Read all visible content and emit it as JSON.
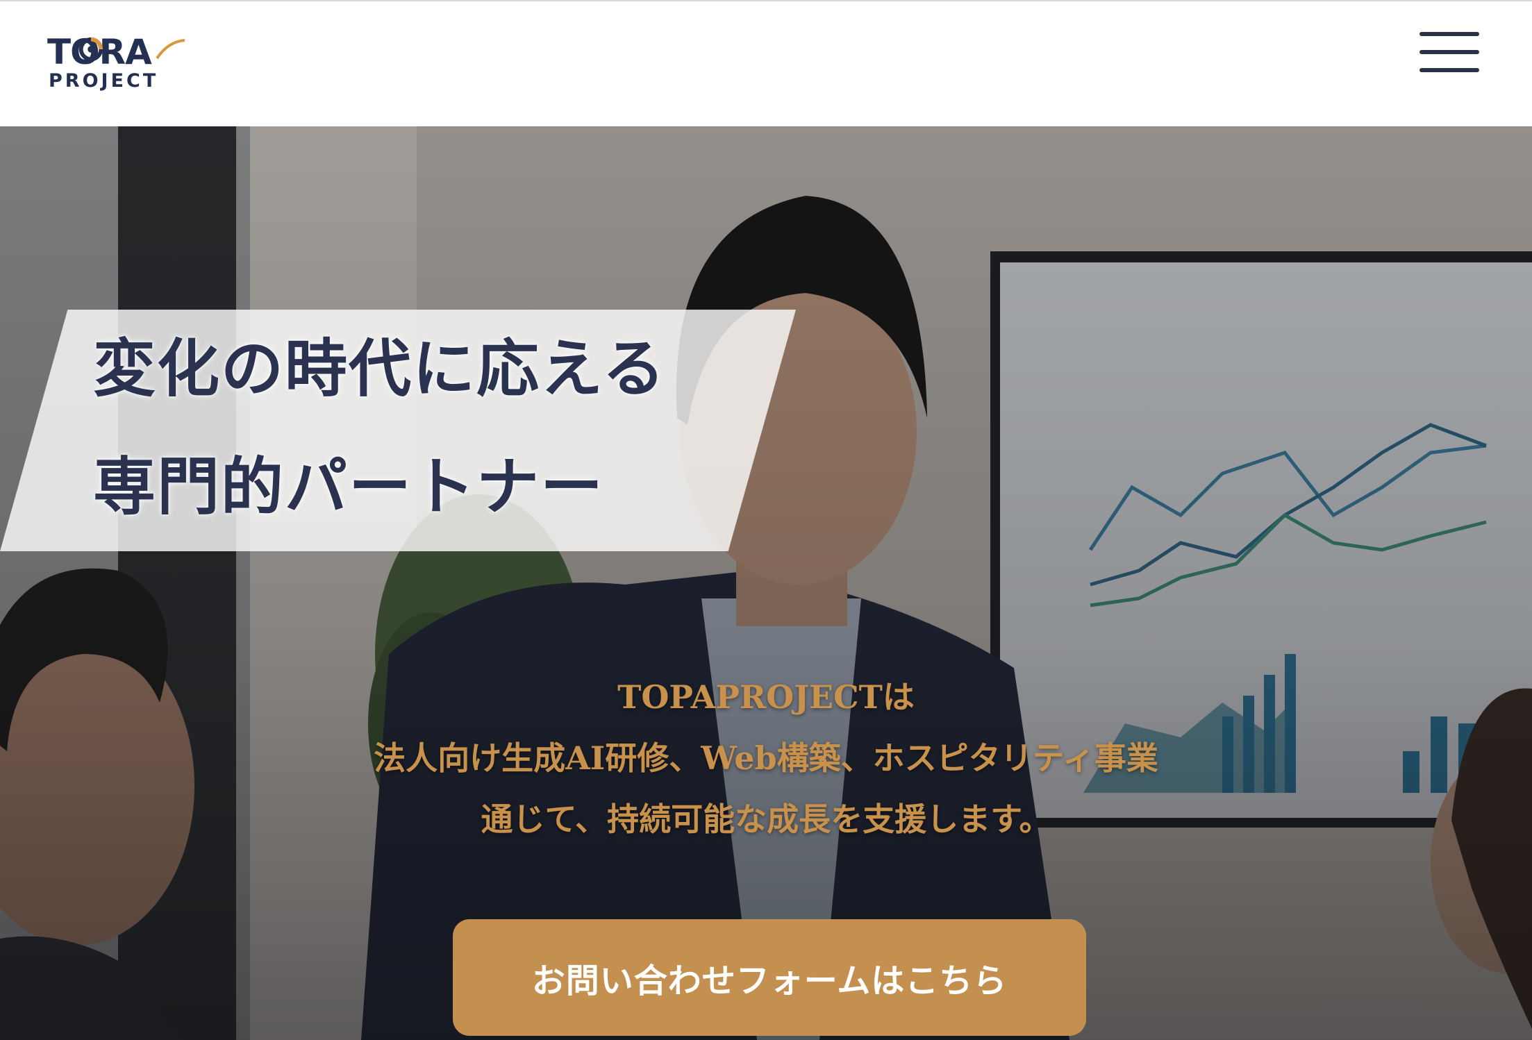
{
  "header": {
    "logo": {
      "line1": "TORA",
      "line2": "PROJECT"
    },
    "menu_icon": "hamburger-menu-icon"
  },
  "hero": {
    "headline": {
      "line1": "変化の時代に応える",
      "line2": "専門的パートナー"
    },
    "lead": {
      "line1": "TOPAPROJECTは",
      "line2": "法人向け生成AI研修、Web構築、ホスピタリティ事業",
      "line3": "通じて、持続可能な成長を支援します。"
    },
    "cta_label": "お問い合わせフォームはこちら"
  },
  "colors": {
    "brand_navy": "#233052",
    "accent_gold": "#c4904f",
    "lead_gold": "#c8914c"
  }
}
